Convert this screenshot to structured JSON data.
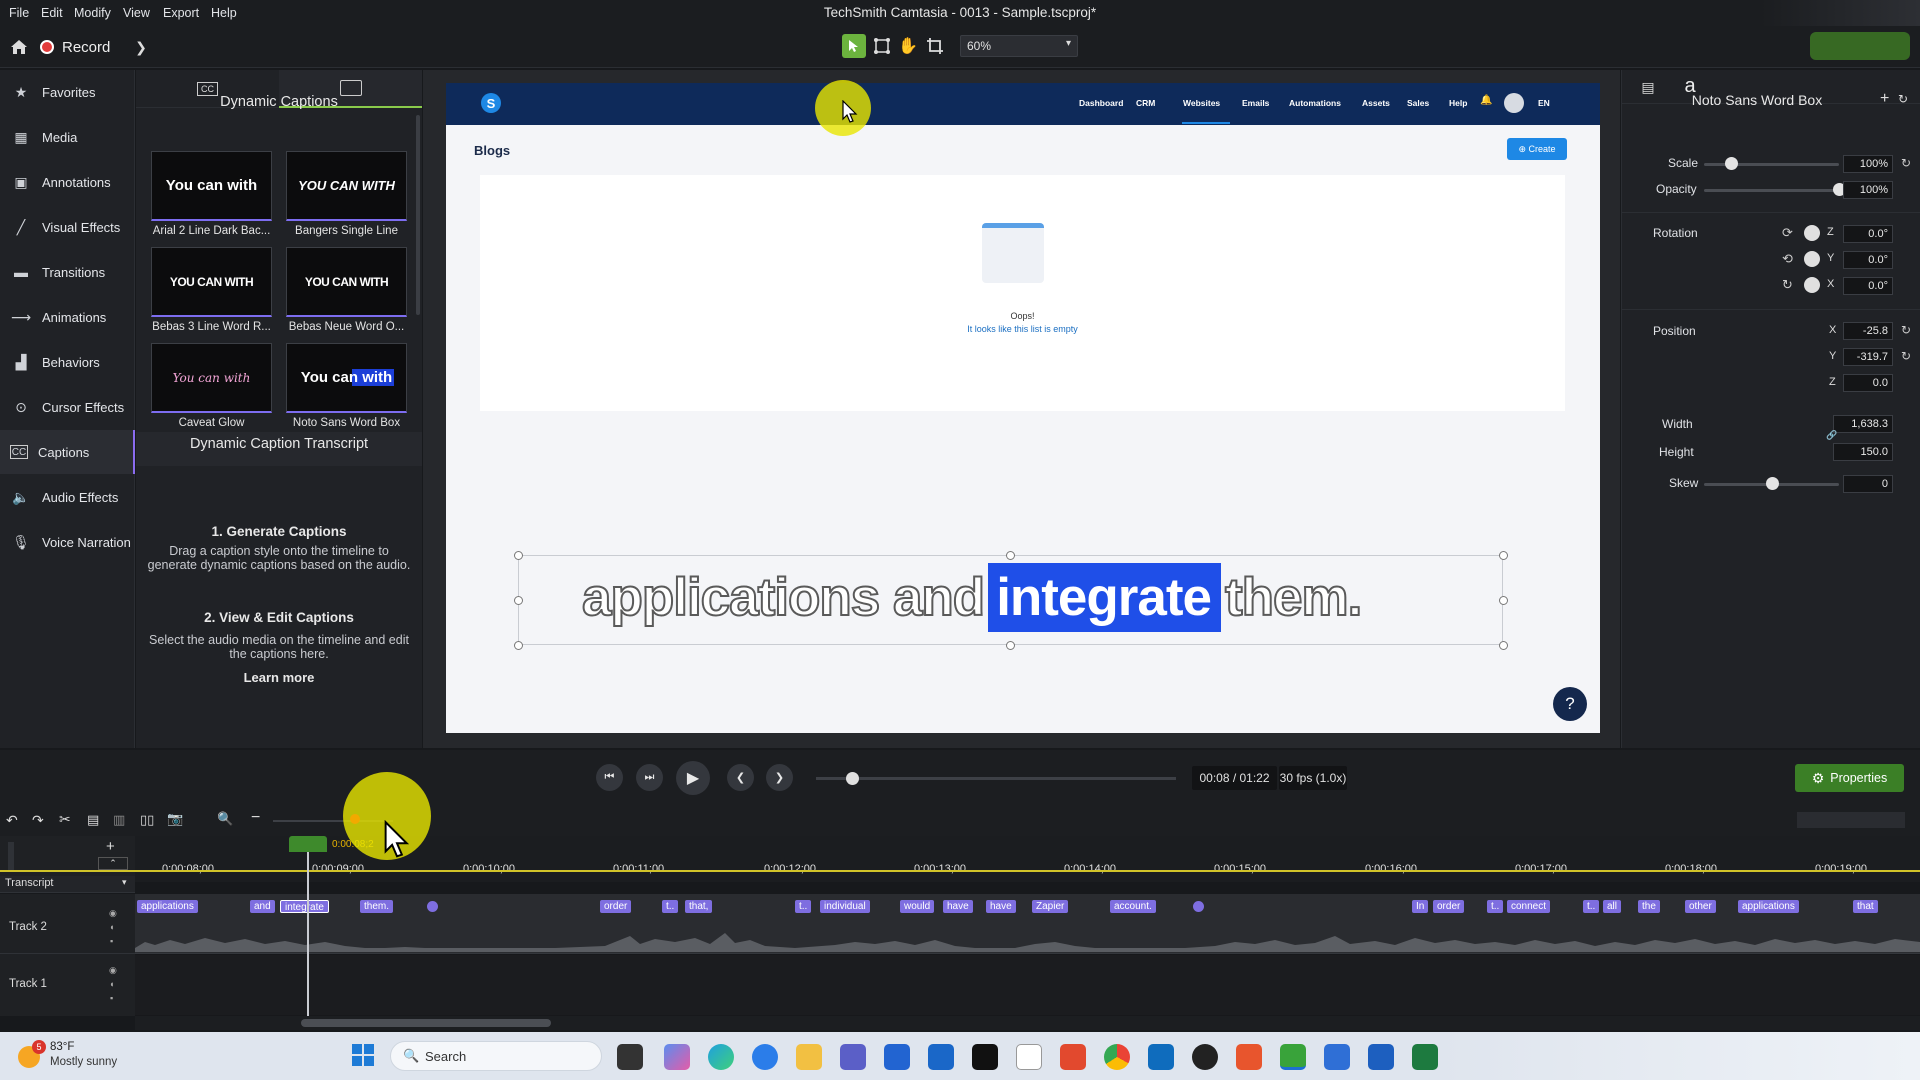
{
  "window": {
    "title": "TechSmith Camtasia - 0013 - Sample.tscproj*"
  },
  "menu": [
    "File",
    "Edit",
    "Modify",
    "View",
    "Export",
    "Help"
  ],
  "toolbar": {
    "record_label": "Record",
    "zoom": "60%"
  },
  "nav": [
    {
      "label": "Favorites",
      "icon": "star-icon"
    },
    {
      "label": "Media",
      "icon": "media-bin-icon"
    },
    {
      "label": "Annotations",
      "icon": "annotation-icon"
    },
    {
      "label": "Visual Effects",
      "icon": "visual-effects-icon"
    },
    {
      "label": "Transitions",
      "icon": "transitions-icon"
    },
    {
      "label": "Animations",
      "icon": "animations-icon"
    },
    {
      "label": "Behaviors",
      "icon": "behaviors-icon"
    },
    {
      "label": "Cursor Effects",
      "icon": "cursor-effects-icon"
    },
    {
      "label": "Captions",
      "icon": "captions-icon",
      "active": true
    },
    {
      "label": "Audio Effects",
      "icon": "audio-effects-icon"
    },
    {
      "label": "Voice Narration",
      "icon": "microphone-icon"
    }
  ],
  "library": {
    "title": "Dynamic Captions",
    "styles": [
      {
        "preview": "You can with",
        "label": "Arial 2 Line Dark Bac..."
      },
      {
        "preview": "YOU CAN WITH",
        "label": "Bangers Single Line"
      },
      {
        "preview": "YOU CAN WITH",
        "label": "Bebas 3 Line Word R..."
      },
      {
        "preview": "YOU CAN WITH",
        "label": "Bebas Neue Word O..."
      },
      {
        "preview": "You can with",
        "label": "Caveat Glow"
      },
      {
        "preview": "You can with",
        "label": "Noto Sans Word Box"
      }
    ],
    "transcript_title": "Dynamic Caption Transcript",
    "step1_title": "1. Generate Captions",
    "step1_text": "Drag a caption style onto the timeline to generate dynamic captions based on the audio.",
    "step2_title": "2. View & Edit Captions",
    "step2_text": "Select the audio media on the timeline and edit the captions here.",
    "learn_more": "Learn more"
  },
  "preview": {
    "site_logo": "S",
    "nav_links": [
      "Dashboard",
      "CRM",
      "Websites",
      "Emails",
      "Automations",
      "Assets",
      "Sales",
      "Help"
    ],
    "lang": "EN",
    "page_title": "Blogs",
    "create_label": "Create",
    "empty_title": "Oops!",
    "empty_text": "It looks like this list is empty",
    "help_label": "?",
    "caption": {
      "before": "applications and",
      "highlight": "integrate",
      "after": "them."
    }
  },
  "properties": {
    "title": "Noto Sans Word Box",
    "scale_label": "Scale",
    "scale": "100%",
    "scale_level": 0.2,
    "opacity_label": "Opacity",
    "opacity": "100%",
    "opacity_level": 1.0,
    "rotation_label": "Rotation",
    "rotation": [
      {
        "axis": "Z",
        "value": "0.0°"
      },
      {
        "axis": "Y",
        "value": "0.0°"
      },
      {
        "axis": "X",
        "value": "0.0°"
      }
    ],
    "position_label": "Position",
    "position": [
      {
        "axis": "X",
        "value": "-25.8"
      },
      {
        "axis": "Y",
        "value": "-319.7"
      },
      {
        "axis": "Z",
        "value": "0.0"
      }
    ],
    "width_label": "Width",
    "width": "1,638.3",
    "height_label": "Height",
    "height": "150.0",
    "skew_label": "Skew",
    "skew": "0",
    "skew_level": 0.5
  },
  "playback": {
    "time": "00:08 / 01:22",
    "fps": "30 fps (1.0x)",
    "properties_label": "Properties",
    "progress": 0.1
  },
  "timeline": {
    "playhead_time": "0:00:08;2",
    "ruler": [
      "0:00:08;00",
      "0:00:09;00",
      "0:00:10;00",
      "0:00:11;00",
      "0:00:12;00",
      "0:00:13;00",
      "0:00:14;00",
      "0:00:15;00",
      "0:00:16;00",
      "0:00:17;00",
      "0:00:18;00",
      "0:00:19;00"
    ],
    "transcript_label": "Transcript",
    "tracks": [
      "Track 2",
      "Track 1"
    ],
    "words": [
      "applications",
      "and",
      "integrate",
      "them.",
      "order",
      "t..",
      "that,",
      "t..",
      "individual",
      "would",
      "have",
      "have",
      "Zapier",
      "account.",
      "In",
      "order",
      "t..",
      "connect",
      "t..",
      "all",
      "the",
      "other",
      "applications",
      "that"
    ]
  },
  "taskbar": {
    "temp": "83°F",
    "weather": "Mostly sunny",
    "badge": "5",
    "search_placeholder": "Search"
  }
}
